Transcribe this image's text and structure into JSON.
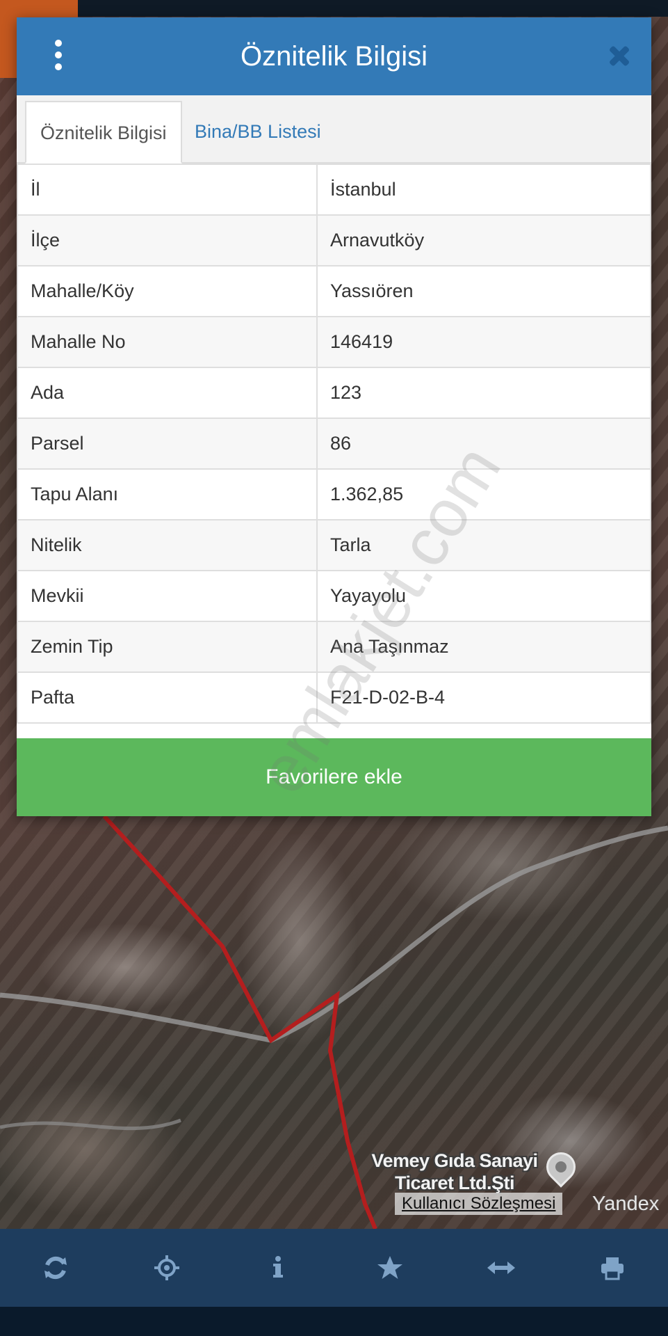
{
  "dialog": {
    "title": "Öznitelik Bilgisi",
    "tabs": [
      {
        "label": "Öznitelik Bilgisi",
        "active": true
      },
      {
        "label": "Bina/BB Listesi",
        "active": false
      }
    ],
    "rows": [
      {
        "key": "İl",
        "value": "İstanbul"
      },
      {
        "key": "İlçe",
        "value": "Arnavutköy"
      },
      {
        "key": "Mahalle/Köy",
        "value": "Yassıören"
      },
      {
        "key": "Mahalle No",
        "value": "146419"
      },
      {
        "key": "Ada",
        "value": "123"
      },
      {
        "key": "Parsel",
        "value": "86"
      },
      {
        "key": "Tapu Alanı",
        "value": "1.362,85"
      },
      {
        "key": "Nitelik",
        "value": "Tarla"
      },
      {
        "key": "Mevkii",
        "value": "Yayayolu"
      },
      {
        "key": "Zemin Tip",
        "value": "Ana Taşınmaz"
      },
      {
        "key": "Pafta",
        "value": "F21-D-02-B-4"
      }
    ],
    "favorite_label": "Favorilere ekle",
    "watermark": "emlakjet.com"
  },
  "map": {
    "poi_label": "Vemey Gıda Sanayi Ticaret Ltd.Şti",
    "terms_link": "Kullanıcı Sözleşmesi",
    "provider": "Yandex"
  },
  "toolbar": {
    "items": [
      "refresh-icon",
      "locate-icon",
      "info-icon",
      "star-icon",
      "measure-icon",
      "print-icon"
    ]
  },
  "colors": {
    "header": "#337ab7",
    "favorite": "#5cb85c",
    "toolbar": "#1e3d5e",
    "parcel_border": "#b41e1e"
  }
}
